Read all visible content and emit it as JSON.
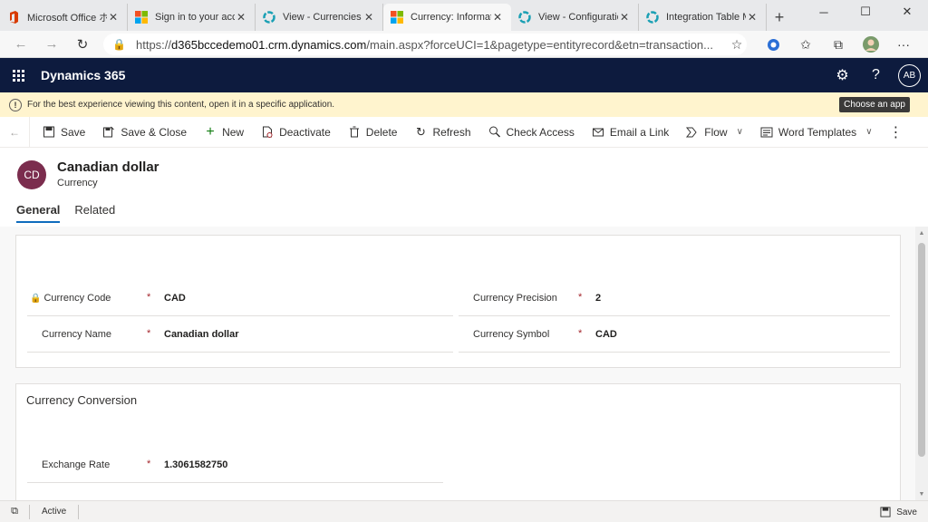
{
  "browser": {
    "tabs": [
      {
        "title": "Microsoft Office ホーム",
        "active": false
      },
      {
        "title": "Sign in to your account",
        "active": false
      },
      {
        "title": "View - Currencies - D",
        "active": false
      },
      {
        "title": "Currency: Informatio",
        "active": true
      },
      {
        "title": "View - Configuration",
        "active": false
      },
      {
        "title": "Integration Table Ma",
        "active": false
      }
    ],
    "url_prefix": "https://",
    "url_host": "d365bccedemo01.crm.dynamics.com",
    "url_path": "/main.aspx?forceUCI=1&pagetype=entityrecord&etn=transaction..."
  },
  "app": {
    "name": "Dynamics 365",
    "user_initials": "AB"
  },
  "notification": {
    "text": "For the best experience viewing this content, open it in a specific application.",
    "tooltip": "Choose an app"
  },
  "commands": {
    "save": "Save",
    "save_close": "Save & Close",
    "new": "New",
    "deactivate": "Deactivate",
    "delete": "Delete",
    "refresh": "Refresh",
    "check_access": "Check Access",
    "email_link": "Email a Link",
    "flow": "Flow",
    "word_templates": "Word Templates"
  },
  "record": {
    "initials": "CD",
    "title": "Canadian dollar",
    "entity": "Currency"
  },
  "form_tabs": {
    "general": "General",
    "related": "Related"
  },
  "general_section": {
    "currency_code_label": "Currency Code",
    "currency_code_value": "CAD",
    "currency_name_label": "Currency Name",
    "currency_name_value": "Canadian dollar",
    "currency_precision_label": "Currency Precision",
    "currency_precision_value": "2",
    "currency_symbol_label": "Currency Symbol",
    "currency_symbol_value": "CAD",
    "required_mark": "*"
  },
  "conversion_section": {
    "title": "Currency Conversion",
    "exchange_rate_label": "Exchange Rate",
    "exchange_rate_value": "1.3061582750",
    "required_mark": "*"
  },
  "statusbar": {
    "status": "Active",
    "save": "Save"
  },
  "colors": {
    "app_header": "#0d1b3e",
    "record_avatar": "#7b2d4e",
    "notification_bg": "#fff4ce",
    "required": "#a4262c",
    "tab_accent": "#0f6cbd"
  }
}
